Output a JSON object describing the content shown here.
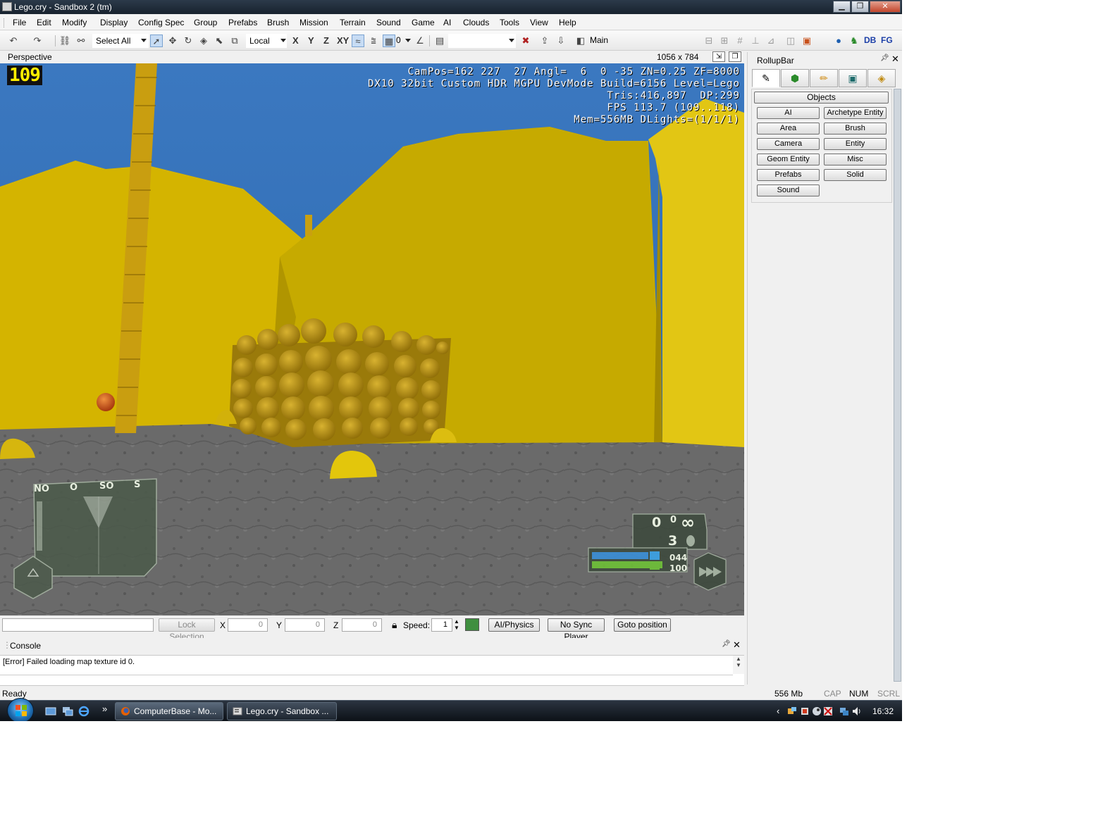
{
  "window": {
    "title": "Lego.cry - Sandbox 2 (tm)",
    "min": "▁",
    "max": "❐",
    "close": "✕"
  },
  "menu": [
    "File",
    "Edit",
    "Modify",
    "Display",
    "Config Spec",
    "Group",
    "Prefabs",
    "Brush",
    "Mission",
    "Terrain",
    "Sound",
    "Game",
    "AI",
    "Clouds",
    "Tools",
    "View",
    "Help"
  ],
  "toolbar": {
    "selection_filter": "Select All",
    "coord_system": "Local",
    "axis_x": "X",
    "axis_y": "Y",
    "axis_z": "Z",
    "axis_xy": "XY",
    "grid_value": "0",
    "layer": "Main",
    "db_label": "DB",
    "fg_label": "FG"
  },
  "viewport": {
    "title": "Perspective",
    "size": "1056 x 784",
    "fps_counter": "109",
    "stats": [
      "CamPos=162 227  27 Angl=  6  0 -35 ZN=0.25 ZF=8000",
      "DX10 32bit Custom HDR MGPU DevMode Build=6156 Level=Lego",
      "Tris:416,897  DP:299",
      "FPS 113.7 (109..118)",
      "Mem=556MB DLights=(1/1/1)"
    ],
    "hud": {
      "compass": [
        "NO",
        "O",
        "SO",
        "S"
      ],
      "ammo_clip": "0",
      "ammo_reserve": "0",
      "ammo_infinite": "∞",
      "grenades": "3",
      "energy": "044",
      "health": "100"
    }
  },
  "bottom_bar": {
    "lock_selection": "Lock Selection",
    "x_label": "X",
    "x_value": "0",
    "y_label": "Y",
    "y_value": "0",
    "z_label": "Z",
    "z_value": "0",
    "speed_label": "Speed:",
    "speed_value": "1",
    "ai_physics": "AI/Physics",
    "no_sync_player": "No Sync Player",
    "goto_position": "Goto position"
  },
  "console": {
    "title": "Console",
    "lines": [
      "[Error] Failed loading map texture id 0."
    ]
  },
  "statusline": {
    "left": "Ready",
    "memory": "556 Mb",
    "cap": "CAP",
    "num": "NUM",
    "scrl": "SCRL"
  },
  "rollup": {
    "title": "RollupBar",
    "section": "Objects",
    "buttons": [
      "AI",
      "Archetype Entity",
      "Area",
      "Brush",
      "Camera",
      "Entity",
      "Geom Entity",
      "Misc",
      "Prefabs",
      "Solid",
      "Sound"
    ]
  },
  "taskbar": {
    "tasks": [
      "ComputerBase - Mo...",
      "Lego.cry - Sandbox ..."
    ],
    "clock": "16:32",
    "overflow": "»",
    "tray_arrow": "‹"
  }
}
